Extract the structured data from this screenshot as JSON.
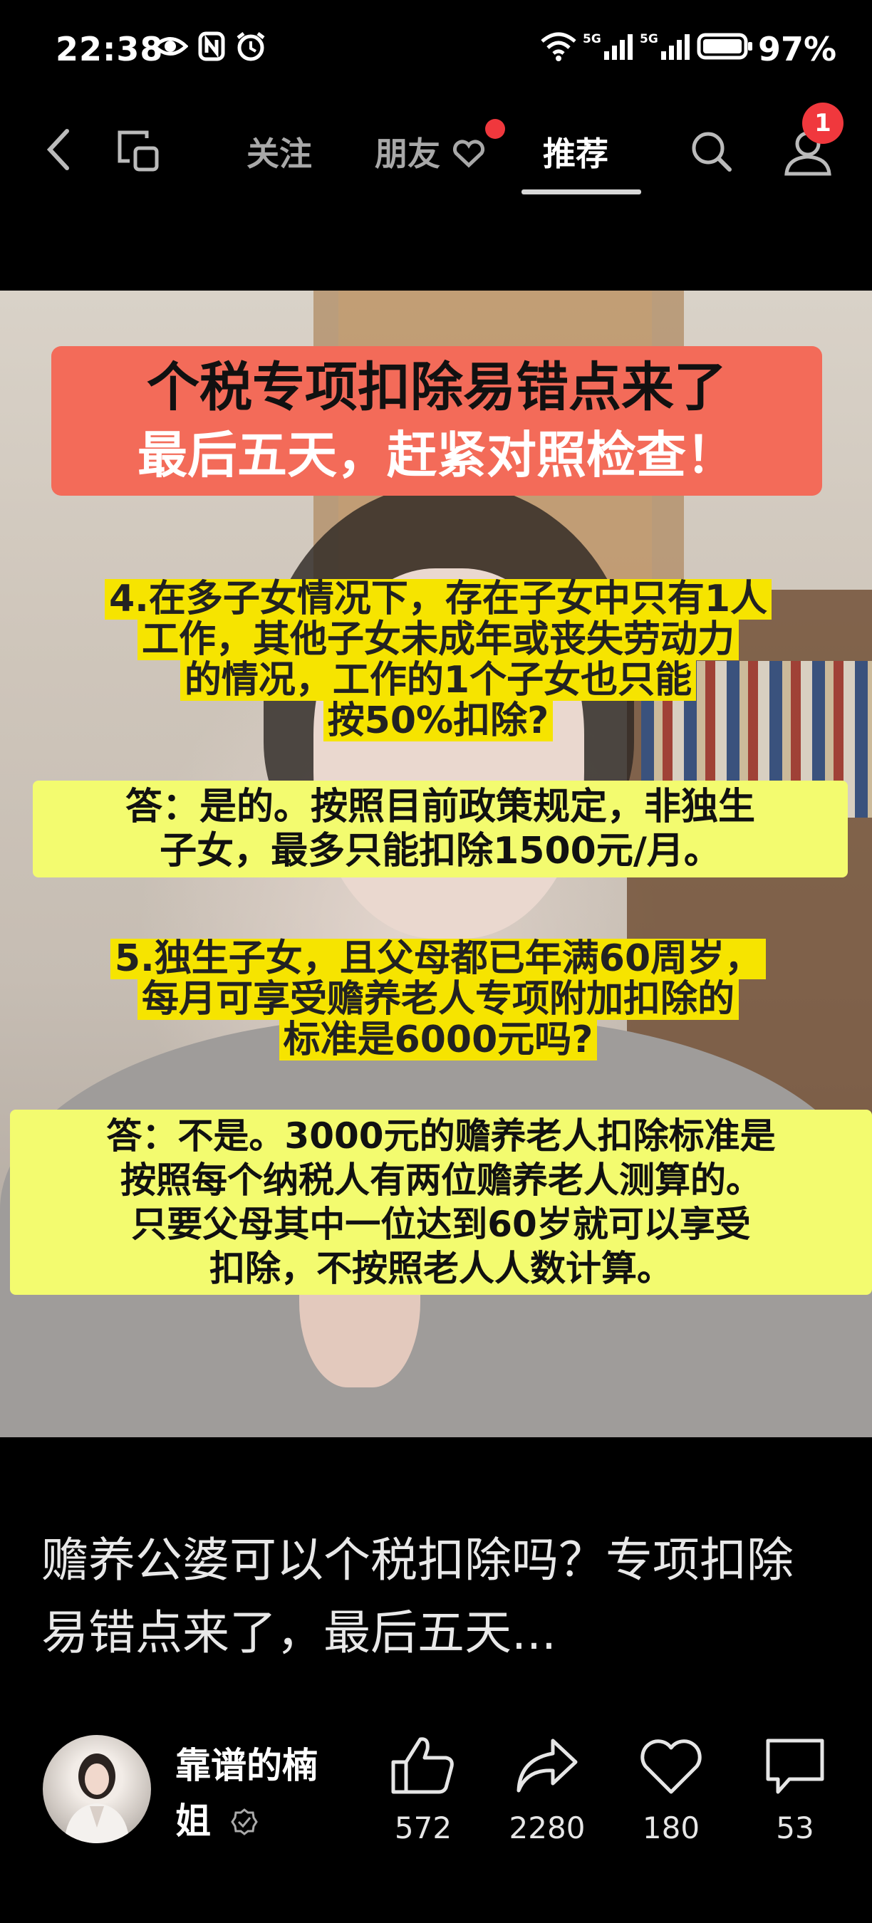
{
  "status_bar": {
    "time": "22:38",
    "battery": "97%",
    "icons": [
      "eye-icon",
      "nfc-icon",
      "alarm-icon",
      "wifi-icon",
      "signal-5g-icon",
      "signal-5g-icon",
      "battery-icon"
    ]
  },
  "nav": {
    "tabs": [
      {
        "label": "关注",
        "active": false
      },
      {
        "label": "朋友",
        "active": false
      },
      {
        "label": "推荐",
        "active": true
      }
    ],
    "notification_count": "1"
  },
  "video": {
    "banner_line1": "个税专项扣除易错点来了",
    "banner_line2": "最后五天，赶紧对照检查！",
    "q4": [
      "4.在多子女情况下，存在子女中只有1人",
      "工作，其他子女未成年或丧失劳动力",
      "的情况，工作的1个子女也只能",
      "按50%扣除?"
    ],
    "a4": [
      "答：是的。按照目前政策规定，非独生",
      "子女，最多只能扣除1500元/月。"
    ],
    "q5": [
      "5.独生子女，且父母都已年满60周岁，",
      "每月可享受赡养老人专项附加扣除的",
      "标准是6000元吗?"
    ],
    "a5": [
      "答：不是。3000元的赡养老人扣除标准是",
      "按照每个纳税人有两位赡养老人测算的。",
      "只要父母其中一位达到60岁就可以享受",
      "扣除，不按照老人人数计算。"
    ]
  },
  "caption": "赡养公婆可以个税扣除吗？专项扣除易错点来了，最后五天...",
  "author": {
    "name_line1": "靠谱的楠",
    "name_line2": "姐"
  },
  "actions": [
    {
      "icon": "like-icon",
      "count": "572"
    },
    {
      "icon": "share-icon",
      "count": "2280"
    },
    {
      "icon": "heart-icon",
      "count": "180"
    },
    {
      "icon": "comment-icon",
      "count": "53"
    }
  ],
  "colors": {
    "accent_red": "#f0383d",
    "banner": "#f36b59",
    "highlight": "#f3fb6f"
  }
}
